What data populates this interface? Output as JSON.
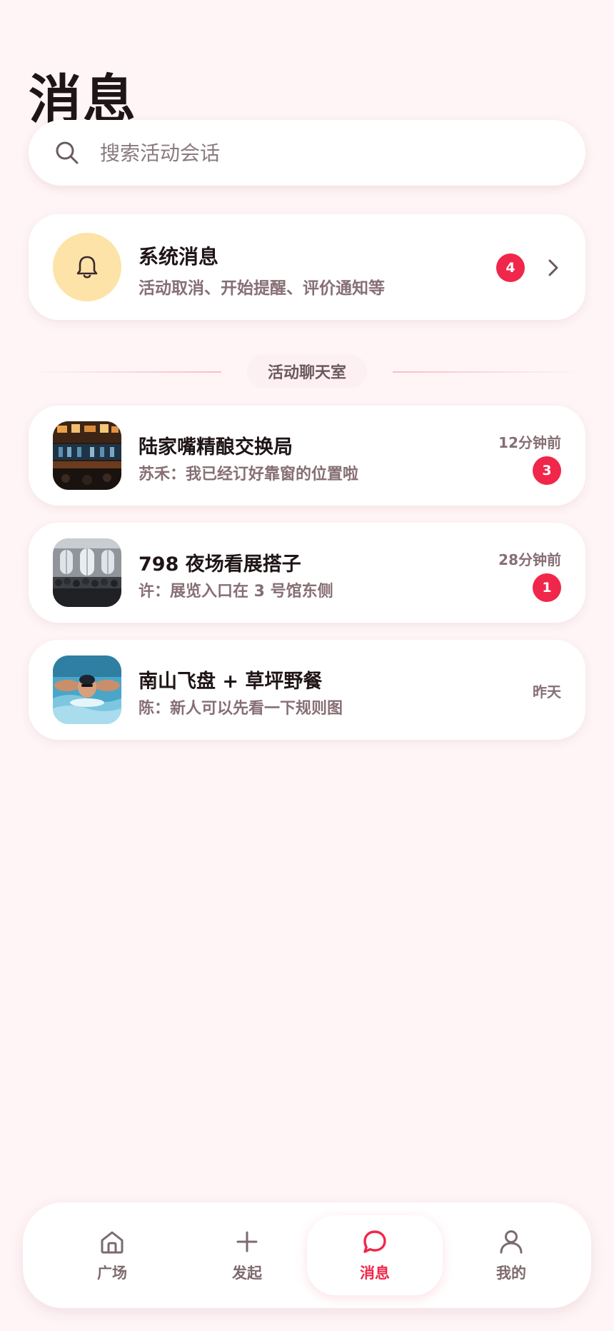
{
  "page": {
    "title": "消息"
  },
  "search": {
    "placeholder": "搜索活动会话",
    "value": "",
    "icon": "search-icon"
  },
  "system": {
    "title": "系统消息",
    "subtitle": "活动取消、开始提醒、评价通知等",
    "badge": "4",
    "icon": "bell-icon"
  },
  "section": {
    "label": "活动聊天室"
  },
  "chats": [
    {
      "title": "陆家嘴精酿交换局",
      "message": "苏禾：我已经订好靠窗的位置啦",
      "time": "12分钟前",
      "badge": "3",
      "thumb": "bar-interior-photo"
    },
    {
      "title": "798 夜场看展搭子",
      "message": "许：展览入口在 3 号馆东侧",
      "time": "28分钟前",
      "badge": "1",
      "thumb": "exhibition-hall-photo"
    },
    {
      "title": "南山飞盘 + 草坪野餐",
      "message": "陈：新人可以先看一下规则图",
      "time": "昨天",
      "badge": "",
      "thumb": "swimmer-photo"
    }
  ],
  "tabbar": {
    "items": [
      {
        "label": "广场",
        "icon": "home-icon",
        "active": false
      },
      {
        "label": "发起",
        "icon": "plus-icon",
        "active": false
      },
      {
        "label": "消息",
        "icon": "chat-bubble-icon",
        "active": true
      },
      {
        "label": "我的",
        "icon": "user-icon",
        "active": false
      }
    ]
  },
  "colors": {
    "accent": "#f0274a",
    "background": "#fff5f6",
    "bell_circle": "#fde3a8",
    "muted_text": "#866f74"
  }
}
